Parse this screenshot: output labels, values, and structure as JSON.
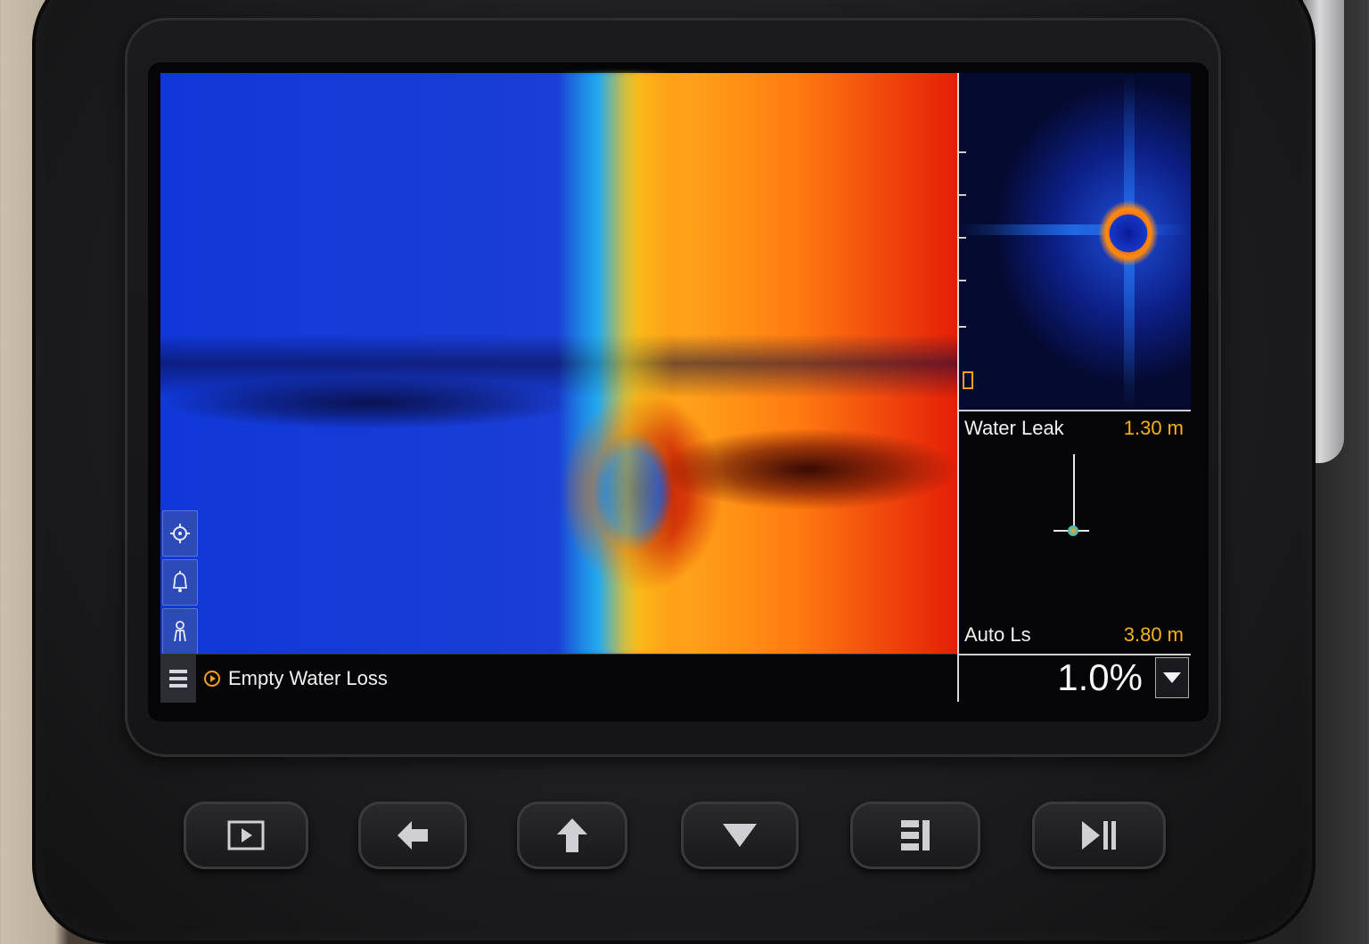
{
  "status_bar": {
    "mode_label": "Empty Water Loss"
  },
  "readout": {
    "top_label": "Water Leak",
    "top_value": "1.30 m",
    "bottom_label": "Auto Ls",
    "bottom_value": "3.80 m"
  },
  "zoom": {
    "value": "1.0%"
  },
  "icons": {
    "tool_1": "crosshair-icon",
    "tool_2": "bell-icon",
    "tool_3": "figure-icon",
    "menu": "menu-icon",
    "mode": "record-icon",
    "dropdown": "chevron-down-icon",
    "hw_1": "play-icon",
    "hw_2": "arrow-left-icon",
    "hw_3": "arrow-up-icon",
    "hw_4": "arrow-down-icon",
    "hw_5": "grid-menu-icon",
    "hw_6": "skip-next-icon"
  },
  "colors": {
    "accent": "#f5b31a",
    "text": "#f2f2f2"
  }
}
